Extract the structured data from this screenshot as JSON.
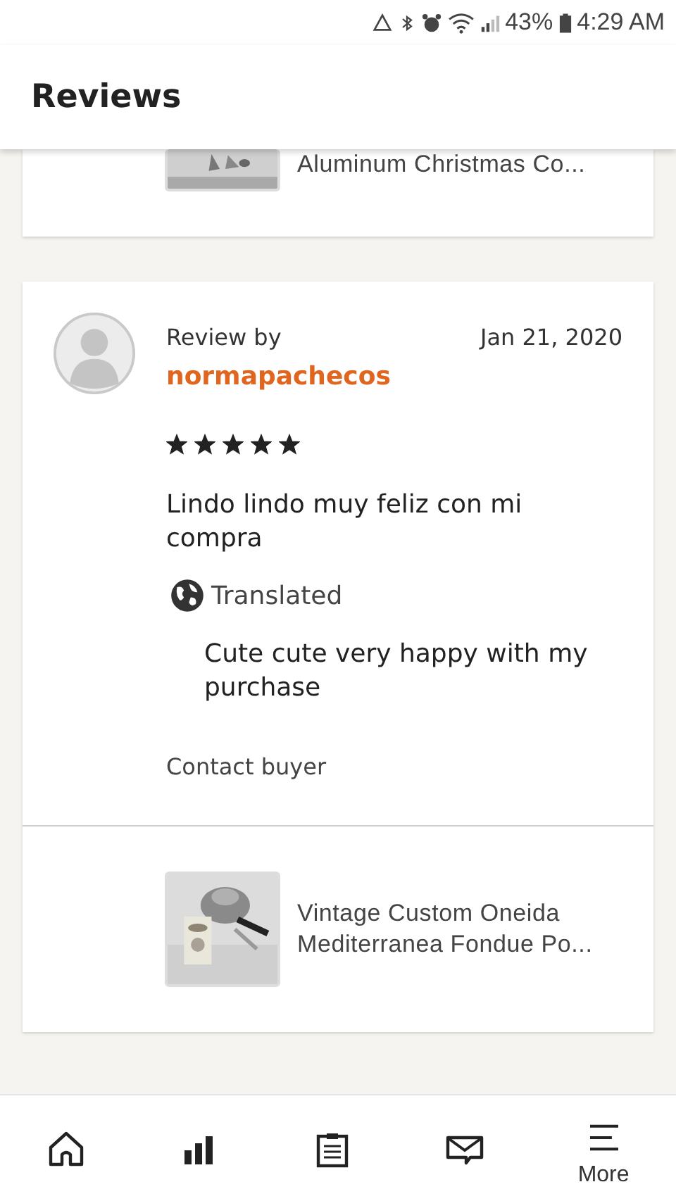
{
  "status_bar": {
    "battery": "43%",
    "time": "4:29 AM"
  },
  "header": {
    "title": "Reviews"
  },
  "previous_card": {
    "product_title": "Aluminum Christmas Co..."
  },
  "review": {
    "label": "Review by",
    "date": "Jan 21, 2020",
    "reviewer": "normapachecos",
    "stars": 5,
    "text": "Lindo lindo muy feliz con mi compra",
    "translated_label": "Translated",
    "translation": "Cute cute very happy with my purchase",
    "contact": "Contact buyer",
    "product_title": "Vintage Custom Oneida Mediterranea Fondue Po..."
  },
  "bottom_nav": {
    "more_label": "More"
  }
}
